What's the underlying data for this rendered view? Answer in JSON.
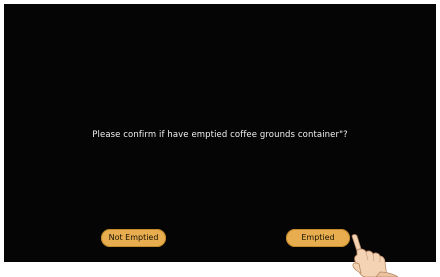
{
  "dialog": {
    "message": "Please confirm if have emptied coffee grounds container\"?"
  },
  "buttons": {
    "not_emptied_label": "Not Emptied",
    "emptied_label": "Emptied"
  },
  "colors": {
    "screen_background": "#050505",
    "button_fill": "#e7ad4e",
    "message_text": "#f2f2f2"
  },
  "icons": {
    "pointer": "hand-pointer-icon"
  }
}
